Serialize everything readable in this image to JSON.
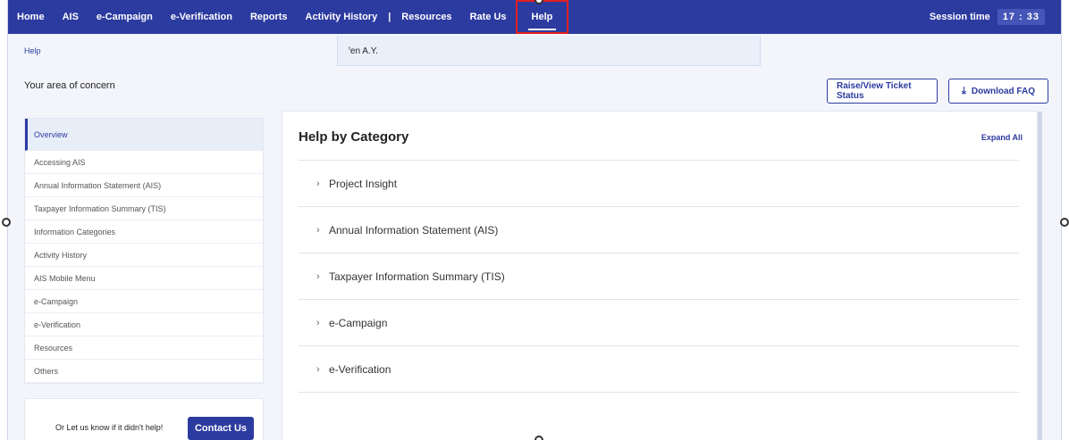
{
  "nav": {
    "items": [
      "Home",
      "AIS",
      "e-Campaign",
      "e-Verification",
      "Reports",
      "Activity History"
    ],
    "separator": "|",
    "items_after": [
      "Resources",
      "Rate Us"
    ],
    "active": "Help",
    "session_label": "Session time",
    "session_time": "17 : 33"
  },
  "breadcrumb": "Help",
  "ay_banner": "ꞌen A.Y.",
  "concern_title": "Your area of concern",
  "buttons": {
    "ticket": "Raise/View Ticket Status",
    "faq": "Download FAQ"
  },
  "sidebar": {
    "active": "Overview",
    "items": [
      "Accessing AIS",
      "Annual Information Statement (AIS)",
      "Taxpayer Information Summary (TIS)",
      "Information Categories",
      "Activity History",
      "AIS Mobile Menu",
      "e-Campaign",
      "e-Verification",
      "Resources",
      "Others"
    ]
  },
  "helpbox": {
    "message": "Or Let us know if it didn't help!",
    "contact": "Contact Us"
  },
  "main": {
    "title": "Help by Category",
    "expand_all": "Expand All",
    "categories": [
      "Project Insight",
      "Annual Information Statement (AIS)",
      "Taxpayer Information Summary (TIS)",
      "e-Campaign",
      "e-Verification"
    ]
  },
  "icons": {
    "chevron": "chevron-right-icon",
    "download": "download-icon"
  },
  "colors": {
    "brand": "#2c3ba0",
    "highlight": "#e02020"
  }
}
